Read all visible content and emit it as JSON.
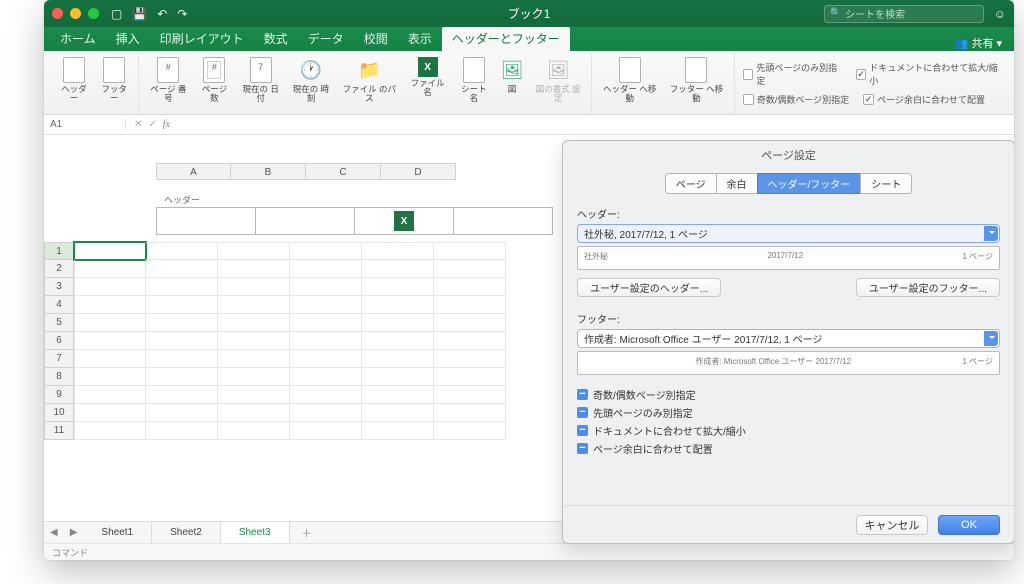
{
  "title": "ブック1",
  "search_ph": "シートを検索",
  "tabs": [
    "ホーム",
    "挿入",
    "印刷レイアウト",
    "数式",
    "データ",
    "校閲",
    "表示",
    "ヘッダーとフッター"
  ],
  "share": "共有",
  "ribbon": {
    "b": [
      "ヘッダー",
      "フッター",
      "ページ\n番号",
      "ページ\n数",
      "現在の\n日付",
      "現在の\n時刻",
      "ファイル\nのパス",
      "ファイル\n名",
      "シート\n名",
      "図",
      "図の書式\n設定",
      "ヘッダー\nへ移動",
      "フッター\nへ移動"
    ],
    "opts": [
      "先頭ページのみ別指定",
      "ドキュメントに合わせて拡大/縮小",
      "奇数/偶数ページ別指定",
      "ページ余白に合わせて配置"
    ],
    "opt_state": [
      false,
      true,
      false,
      true
    ]
  },
  "cell_ref": "A1",
  "cols": [
    "A",
    "B",
    "C",
    "D"
  ],
  "header_label": "ヘッダー",
  "rows": [
    "1",
    "2",
    "3",
    "4",
    "5",
    "6",
    "7",
    "8",
    "9",
    "10",
    "11"
  ],
  "sheet_tabs": [
    "Sheet1",
    "Sheet2",
    "Sheet3"
  ],
  "status": "コマンド",
  "dlg": {
    "title": "ページ設定",
    "segs": [
      "ページ",
      "余白",
      "ヘッダー/フッター",
      "シート"
    ],
    "hdr_label": "ヘッダー:",
    "hdr_combo": "社外秘, 2017/7/12, 1 ページ",
    "hdr_prev_l": "社外秘",
    "hdr_prev_c": "2017/7/12",
    "hdr_prev_r": "1 ページ",
    "btn_h": "ユーザー設定のヘッダー...",
    "btn_f": "ユーザー設定のフッター...",
    "ftr_label": "フッター:",
    "ftr_combo": "作成者: Microsoft Office ユーザー  2017/7/12, 1 ページ",
    "ftr_prev_c": "作成者: Microsoft Office ユーザー 2017/7/12",
    "ftr_prev_r": "1 ページ",
    "chks": [
      "奇数/偶数ページ別指定",
      "先頭ページのみ別指定",
      "ドキュメントに合わせて拡大/縮小",
      "ページ余白に合わせて配置"
    ],
    "cancel": "キャンセル",
    "ok": "OK"
  }
}
